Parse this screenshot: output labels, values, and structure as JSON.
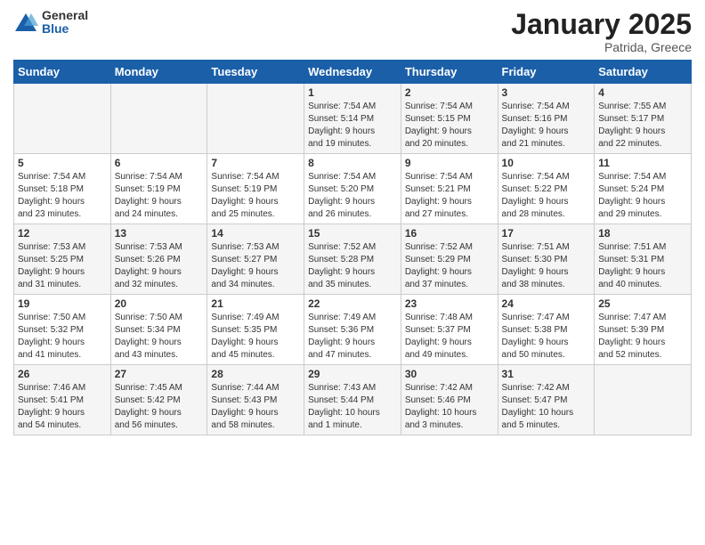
{
  "logo": {
    "general": "General",
    "blue": "Blue"
  },
  "header": {
    "month": "January 2025",
    "location": "Patrida, Greece"
  },
  "weekdays": [
    "Sunday",
    "Monday",
    "Tuesday",
    "Wednesday",
    "Thursday",
    "Friday",
    "Saturday"
  ],
  "weeks": [
    [
      {
        "day": "",
        "info": ""
      },
      {
        "day": "",
        "info": ""
      },
      {
        "day": "",
        "info": ""
      },
      {
        "day": "1",
        "info": "Sunrise: 7:54 AM\nSunset: 5:14 PM\nDaylight: 9 hours\nand 19 minutes."
      },
      {
        "day": "2",
        "info": "Sunrise: 7:54 AM\nSunset: 5:15 PM\nDaylight: 9 hours\nand 20 minutes."
      },
      {
        "day": "3",
        "info": "Sunrise: 7:54 AM\nSunset: 5:16 PM\nDaylight: 9 hours\nand 21 minutes."
      },
      {
        "day": "4",
        "info": "Sunrise: 7:55 AM\nSunset: 5:17 PM\nDaylight: 9 hours\nand 22 minutes."
      }
    ],
    [
      {
        "day": "5",
        "info": "Sunrise: 7:54 AM\nSunset: 5:18 PM\nDaylight: 9 hours\nand 23 minutes."
      },
      {
        "day": "6",
        "info": "Sunrise: 7:54 AM\nSunset: 5:19 PM\nDaylight: 9 hours\nand 24 minutes."
      },
      {
        "day": "7",
        "info": "Sunrise: 7:54 AM\nSunset: 5:19 PM\nDaylight: 9 hours\nand 25 minutes."
      },
      {
        "day": "8",
        "info": "Sunrise: 7:54 AM\nSunset: 5:20 PM\nDaylight: 9 hours\nand 26 minutes."
      },
      {
        "day": "9",
        "info": "Sunrise: 7:54 AM\nSunset: 5:21 PM\nDaylight: 9 hours\nand 27 minutes."
      },
      {
        "day": "10",
        "info": "Sunrise: 7:54 AM\nSunset: 5:22 PM\nDaylight: 9 hours\nand 28 minutes."
      },
      {
        "day": "11",
        "info": "Sunrise: 7:54 AM\nSunset: 5:24 PM\nDaylight: 9 hours\nand 29 minutes."
      }
    ],
    [
      {
        "day": "12",
        "info": "Sunrise: 7:53 AM\nSunset: 5:25 PM\nDaylight: 9 hours\nand 31 minutes."
      },
      {
        "day": "13",
        "info": "Sunrise: 7:53 AM\nSunset: 5:26 PM\nDaylight: 9 hours\nand 32 minutes."
      },
      {
        "day": "14",
        "info": "Sunrise: 7:53 AM\nSunset: 5:27 PM\nDaylight: 9 hours\nand 34 minutes."
      },
      {
        "day": "15",
        "info": "Sunrise: 7:52 AM\nSunset: 5:28 PM\nDaylight: 9 hours\nand 35 minutes."
      },
      {
        "day": "16",
        "info": "Sunrise: 7:52 AM\nSunset: 5:29 PM\nDaylight: 9 hours\nand 37 minutes."
      },
      {
        "day": "17",
        "info": "Sunrise: 7:51 AM\nSunset: 5:30 PM\nDaylight: 9 hours\nand 38 minutes."
      },
      {
        "day": "18",
        "info": "Sunrise: 7:51 AM\nSunset: 5:31 PM\nDaylight: 9 hours\nand 40 minutes."
      }
    ],
    [
      {
        "day": "19",
        "info": "Sunrise: 7:50 AM\nSunset: 5:32 PM\nDaylight: 9 hours\nand 41 minutes."
      },
      {
        "day": "20",
        "info": "Sunrise: 7:50 AM\nSunset: 5:34 PM\nDaylight: 9 hours\nand 43 minutes."
      },
      {
        "day": "21",
        "info": "Sunrise: 7:49 AM\nSunset: 5:35 PM\nDaylight: 9 hours\nand 45 minutes."
      },
      {
        "day": "22",
        "info": "Sunrise: 7:49 AM\nSunset: 5:36 PM\nDaylight: 9 hours\nand 47 minutes."
      },
      {
        "day": "23",
        "info": "Sunrise: 7:48 AM\nSunset: 5:37 PM\nDaylight: 9 hours\nand 49 minutes."
      },
      {
        "day": "24",
        "info": "Sunrise: 7:47 AM\nSunset: 5:38 PM\nDaylight: 9 hours\nand 50 minutes."
      },
      {
        "day": "25",
        "info": "Sunrise: 7:47 AM\nSunset: 5:39 PM\nDaylight: 9 hours\nand 52 minutes."
      }
    ],
    [
      {
        "day": "26",
        "info": "Sunrise: 7:46 AM\nSunset: 5:41 PM\nDaylight: 9 hours\nand 54 minutes."
      },
      {
        "day": "27",
        "info": "Sunrise: 7:45 AM\nSunset: 5:42 PM\nDaylight: 9 hours\nand 56 minutes."
      },
      {
        "day": "28",
        "info": "Sunrise: 7:44 AM\nSunset: 5:43 PM\nDaylight: 9 hours\nand 58 minutes."
      },
      {
        "day": "29",
        "info": "Sunrise: 7:43 AM\nSunset: 5:44 PM\nDaylight: 10 hours\nand 1 minute."
      },
      {
        "day": "30",
        "info": "Sunrise: 7:42 AM\nSunset: 5:46 PM\nDaylight: 10 hours\nand 3 minutes."
      },
      {
        "day": "31",
        "info": "Sunrise: 7:42 AM\nSunset: 5:47 PM\nDaylight: 10 hours\nand 5 minutes."
      },
      {
        "day": "",
        "info": ""
      }
    ]
  ]
}
